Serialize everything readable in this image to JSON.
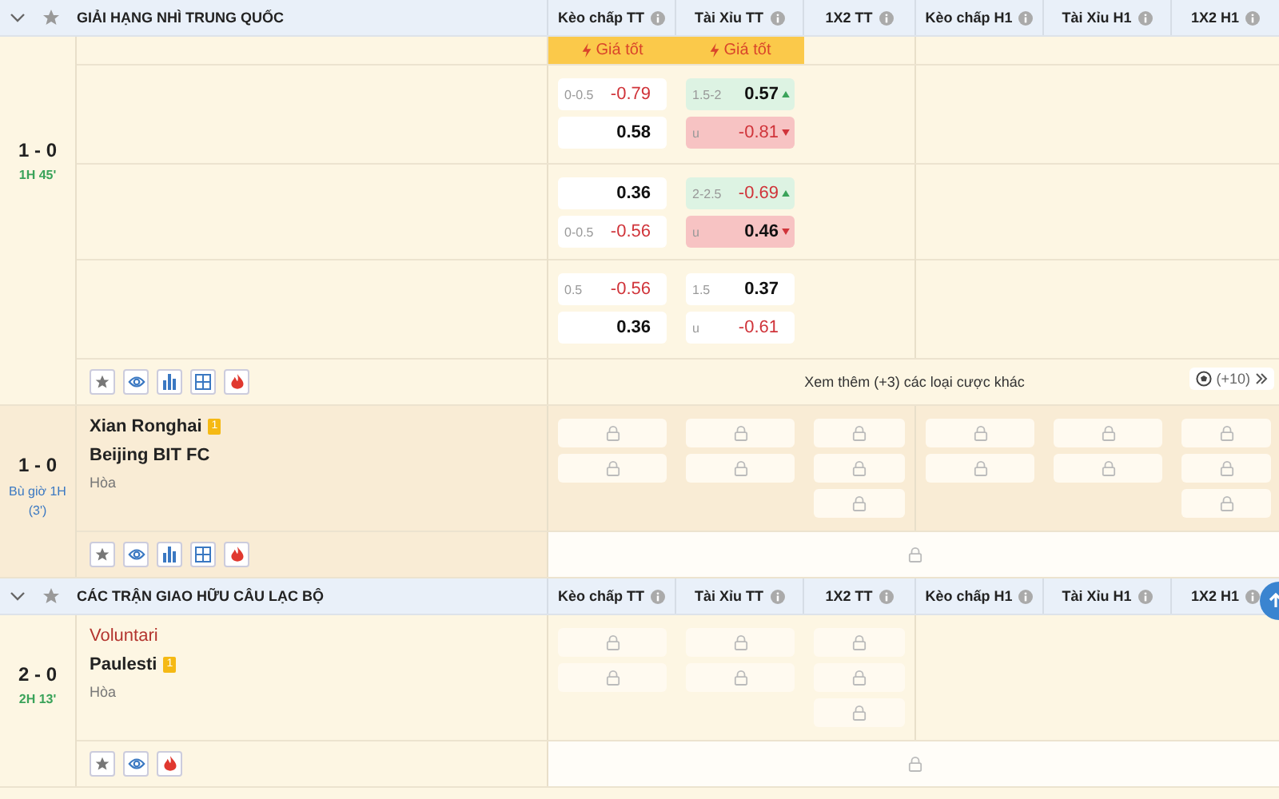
{
  "sections": [
    {
      "title": "GIẢI HẠNG NHÌ TRUNG QUỐC",
      "expanded": true,
      "columns": [
        "Kèo chấp TT",
        "Tài Xỉu TT",
        "1X2 TT",
        "Kèo chấp H1",
        "Tài Xỉu H1",
        "1X2 H1"
      ],
      "matches": [
        {
          "kind": "odds",
          "score": "1 - 0",
          "time": "1H 45'",
          "injury_time": false,
          "best_price": [
            "Giá tốt",
            "Giá tốt"
          ],
          "lines": [
            {
              "handicap": [
                {
                  "label": "0-0.5",
                  "value": "-0.79",
                  "negative": true
                },
                {
                  "value": "0.58",
                  "negative": false
                }
              ],
              "over_under": [
                {
                  "label": "1.5-2",
                  "value": "0.57",
                  "negative": false,
                  "rising": true
                },
                {
                  "label": "u",
                  "value": "-0.81",
                  "negative": true,
                  "falling": true
                }
              ]
            },
            {
              "handicap": [
                {
                  "value": "0.36",
                  "negative": false
                },
                {
                  "label": "0-0.5",
                  "value": "-0.56",
                  "negative": true
                }
              ],
              "over_under": [
                {
                  "label": "2-2.5",
                  "value": "-0.69",
                  "negative": true,
                  "rising": true
                },
                {
                  "label": "u",
                  "value": "0.46",
                  "negative": false,
                  "falling": true
                }
              ]
            },
            {
              "handicap": [
                {
                  "label": "0.5",
                  "value": "-0.56",
                  "negative": true
                },
                {
                  "value": "0.36",
                  "negative": false
                }
              ],
              "over_under": [
                {
                  "label": "1.5",
                  "value": "0.37",
                  "negative": false
                },
                {
                  "label": "u",
                  "value": "-0.61",
                  "negative": true
                }
              ]
            }
          ],
          "actions": [
            {
              "kind": "favorite"
            },
            {
              "kind": "watch"
            },
            {
              "kind": "stats"
            },
            {
              "kind": "lineup"
            },
            {
              "kind": "hot"
            }
          ],
          "more": {
            "text": "Xem thêm (+3) các loại cược khác",
            "count": "(+10)"
          }
        },
        {
          "kind": "locked",
          "score": "1 - 0",
          "time": "Bù giờ 1H (3')",
          "injury_time": true,
          "highlight": true,
          "teams": [
            {
              "name": "Xian Ronghai",
              "favorite": false,
              "card": "1"
            },
            {
              "name": "Beijing BIT FC",
              "favorite": false
            }
          ],
          "draw": "Hòa",
          "markets": [
            [
              {
                "locked": true
              },
              {
                "locked": true
              }
            ],
            [
              {
                "locked": true
              },
              {
                "locked": true
              }
            ],
            [
              {
                "locked": true
              },
              {
                "locked": true
              },
              {
                "locked": true
              }
            ],
            [
              {
                "locked": true
              },
              {
                "locked": true
              }
            ],
            [
              {
                "locked": true
              },
              {
                "locked": true
              }
            ],
            [
              {
                "locked": true
              },
              {
                "locked": true
              },
              {
                "locked": true
              }
            ]
          ],
          "actions": [
            {
              "kind": "favorite"
            },
            {
              "kind": "watch"
            },
            {
              "kind": "stats"
            },
            {
              "kind": "lineup"
            },
            {
              "kind": "hot"
            }
          ],
          "extra_locked": true
        }
      ]
    },
    {
      "title": "CÁC TRẬN GIAO HỮU CÂU LẠC BỘ",
      "expanded": true,
      "columns": [
        "Kèo chấp TT",
        "Tài Xỉu TT",
        "1X2 TT",
        "Kèo chấp H1",
        "Tài Xỉu H1",
        "1X2 H1"
      ],
      "matches": [
        {
          "kind": "locked",
          "score": "2 - 0",
          "time": "2H 13'",
          "injury_time": false,
          "highlight": false,
          "teams": [
            {
              "name": "Voluntari",
              "favorite": true
            },
            {
              "name": "Paulesti",
              "favorite": false,
              "card": "1"
            }
          ],
          "draw": "Hòa",
          "markets": [
            [
              {
                "locked": true
              },
              {
                "locked": true
              }
            ],
            [
              {
                "locked": true
              },
              {
                "locked": true
              }
            ],
            [
              {
                "locked": true
              },
              {
                "locked": true
              },
              {
                "locked": true
              }
            ]
          ],
          "actions": [
            {
              "kind": "favorite"
            },
            {
              "kind": "watch"
            },
            {
              "kind": "hot"
            }
          ],
          "extra_locked": true
        }
      ]
    }
  ]
}
